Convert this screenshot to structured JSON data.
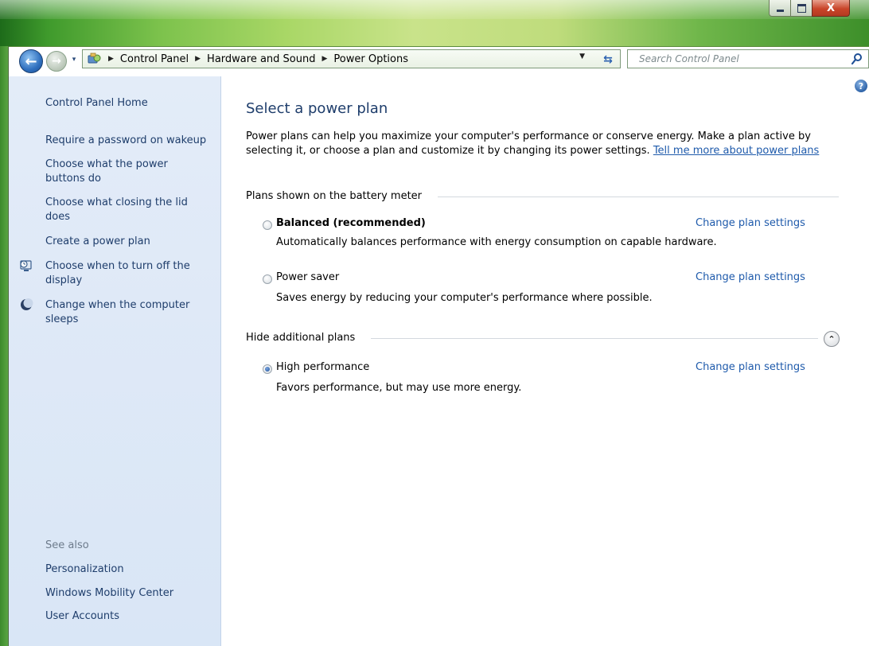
{
  "window": {
    "minimize_icon": "minimize-icon",
    "maximize_icon": "maximize-icon",
    "close_label": "X"
  },
  "navigation": {
    "breadcrumb": [
      "Control Panel",
      "Hardware and Sound",
      "Power Options"
    ],
    "search_placeholder": "Search Control Panel"
  },
  "sidebar": {
    "home": "Control Panel Home",
    "tasks": [
      "Require a password on wakeup",
      "Choose what the power buttons do",
      "Choose what closing the lid does",
      "Create a power plan",
      "Choose when to turn off the display",
      "Change when the computer sleeps"
    ],
    "see_also_label": "See also",
    "see_also": [
      "Personalization",
      "Windows Mobility Center",
      "User Accounts"
    ]
  },
  "main": {
    "title": "Select a power plan",
    "intro_text": "Power plans can help you maximize your computer's performance or conserve energy. Make a plan active by selecting it, or choose a plan and customize it by changing its power settings. ",
    "intro_link": "Tell me more about power plans",
    "battery_group_label": "Plans shown on the battery meter",
    "additional_group_label": "Hide additional plans",
    "change_label": "Change plan settings",
    "plans": [
      {
        "name": "Balanced (recommended)",
        "description": "Automatically balances performance with energy consumption on capable hardware.",
        "selected": false
      },
      {
        "name": "Power saver",
        "description": "Saves energy by reducing your computer's performance where possible.",
        "selected": false
      },
      {
        "name": "High performance",
        "description": "Favors performance, but may use more energy.",
        "selected": true
      }
    ]
  },
  "colors": {
    "link": "#1e5aab",
    "sidebar_link": "#1e3d6b",
    "title": "#1e3d6b",
    "sidebar_bg": "#e3ecf8",
    "titlebar_accent": "#7cc24c"
  }
}
